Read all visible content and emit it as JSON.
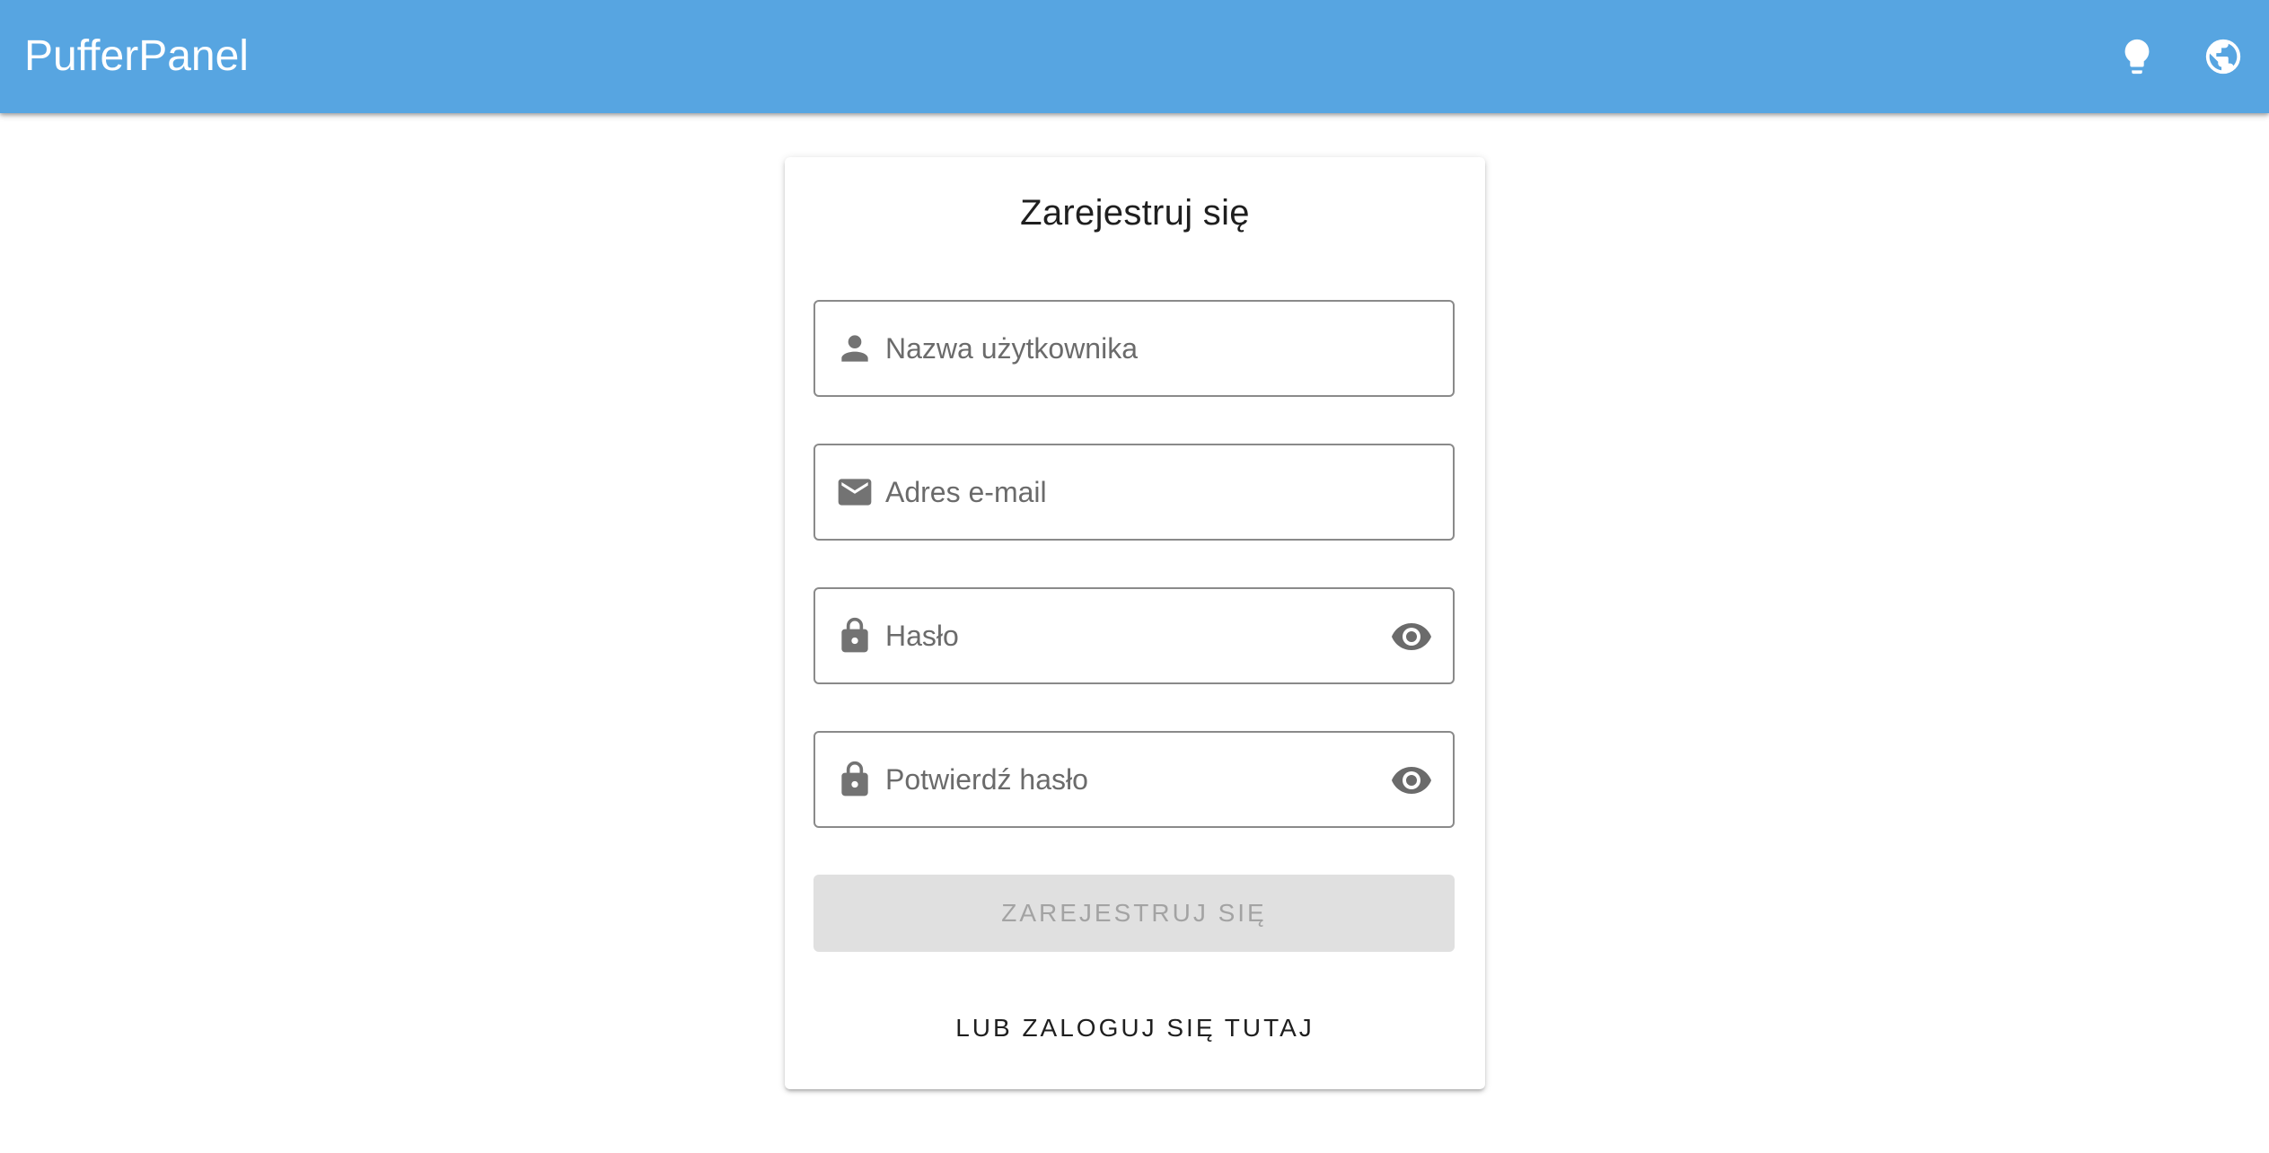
{
  "app": {
    "title": "PufferPanel",
    "header_color": "#57a5e1"
  },
  "header_icons": [
    {
      "name": "lightbulb-icon"
    },
    {
      "name": "globe-icon"
    }
  ],
  "register_form": {
    "title": "Zarejestruj się",
    "fields": {
      "username": {
        "placeholder": "Nazwa użytkownika",
        "value": "",
        "icon": "account-icon"
      },
      "email": {
        "placeholder": "Adres e-mail",
        "value": "",
        "icon": "email-icon"
      },
      "password": {
        "placeholder": "Hasło",
        "value": "",
        "icon": "lock-icon",
        "toggle_icon": "eye-icon"
      },
      "confirm_password": {
        "placeholder": "Potwierdź hasło",
        "value": "",
        "icon": "lock-icon",
        "toggle_icon": "eye-icon"
      }
    },
    "submit_label": "ZAREJESTRUJ SIĘ",
    "submit_disabled": true,
    "login_link_label": "LUB ZALOGUJ SIĘ TUTAJ"
  }
}
